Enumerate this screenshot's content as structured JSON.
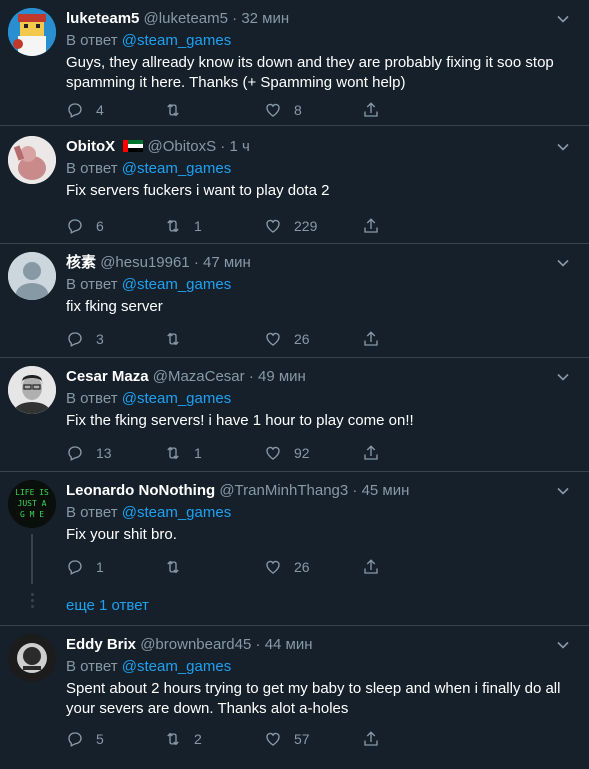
{
  "reply_prefix": "В ответ",
  "tweets": [
    {
      "name": "luketeam5",
      "handle": "@luketeam5",
      "time": "32 мин",
      "reply_to": "@steam_games",
      "text": "Guys, they allready know its down and they are probably fixing it soo stop spamming it here. Thanks (+ Spamming wont help)",
      "replies": "4",
      "retweets": "",
      "likes": "8"
    },
    {
      "name": "ObitoX",
      "handle": "@ObitoxS",
      "time": "1 ч",
      "reply_to": "@steam_games",
      "text": "Fix servers fuckers i want to play dota 2",
      "replies": "6",
      "retweets": "1",
      "likes": "229",
      "flag": "uae-flag"
    },
    {
      "name": "核素",
      "handle": "@hesu19961",
      "time": "47 мин",
      "reply_to": "@steam_games",
      "text": "fix fking server",
      "replies": "3",
      "retweets": "",
      "likes": "26"
    },
    {
      "name": "Cesar Maza",
      "handle": "@MazaCesar",
      "time": "49 мин",
      "reply_to": "@steam_games",
      "text": "Fix the fking servers! i have 1 hour to play come on!!",
      "replies": "13",
      "retweets": "1",
      "likes": "92"
    },
    {
      "name": "Leonardo NoNothing",
      "handle": "@TranMinhThang3",
      "time": "45 мин",
      "reply_to": "@steam_games",
      "text": "Fix your shit bro.",
      "replies": "1",
      "retweets": "",
      "likes": "26",
      "avatar_text": [
        "LIFE IS",
        "JUST A",
        "G   M E"
      ]
    },
    {
      "name": "Eddy Brix",
      "handle": "@brownbeard45",
      "time": "44 мин",
      "reply_to": "@steam_games",
      "text": "Spent about 2 hours trying to get my baby to sleep and when i finally do all your severs are down. Thanks alot a-holes",
      "replies": "5",
      "retweets": "2",
      "likes": "57"
    }
  ],
  "more_replies": "еще 1 ответ",
  "icons": [
    "reply-icon",
    "retweet-icon",
    "like-icon",
    "share-icon",
    "chevron-down-icon"
  ],
  "colors": {
    "background": "#15202b",
    "text": "#ffffff",
    "muted": "#8899a6",
    "link": "#1da1f2",
    "border": "#38444d"
  }
}
